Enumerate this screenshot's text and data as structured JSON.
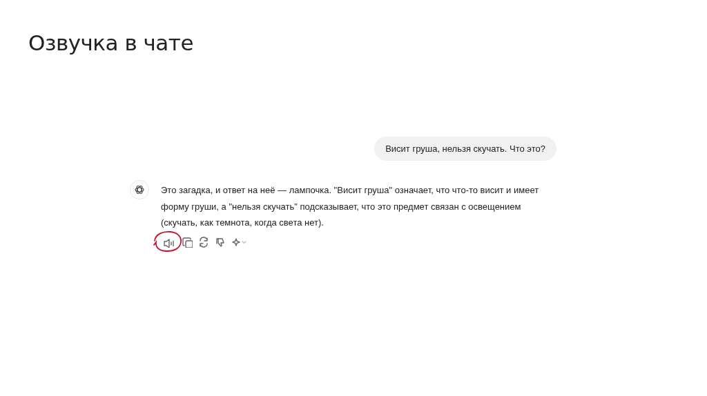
{
  "slide": {
    "title": "Озвучка в чате"
  },
  "chat": {
    "user_message": "Висит груша, нельзя скучать. Что это?",
    "assistant_message": "Это загадка, и ответ на неё — лампочка. \"Висит груша\" означает, что что-то висит и имеет форму груши, а \"нельзя скучать\" подсказывает, что это предмет связан с освещением (скучать, как темнота, когда света нет).",
    "actions": [
      {
        "kind": "speaker",
        "circled": true
      },
      {
        "kind": "copy",
        "circled": false
      },
      {
        "kind": "regenerate",
        "circled": false
      },
      {
        "kind": "dislike",
        "circled": false
      },
      {
        "kind": "model",
        "circled": false
      }
    ]
  }
}
